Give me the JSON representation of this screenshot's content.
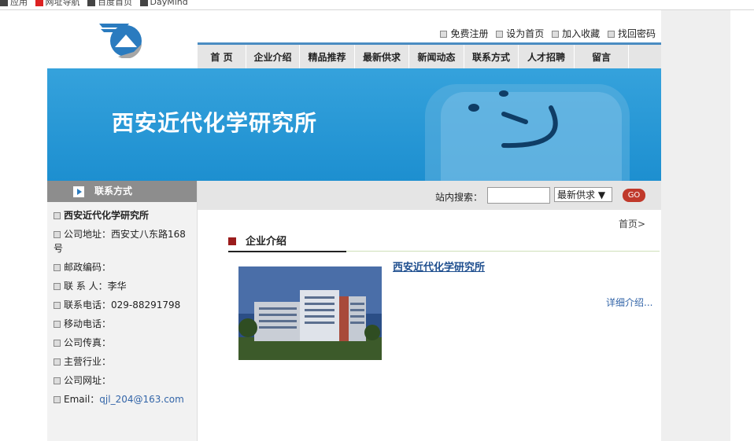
{
  "browser": {
    "bookmarks": [
      {
        "label": "应用",
        "icon": "apps-icon"
      },
      {
        "label": "网址导航",
        "icon": "hao123-icon"
      },
      {
        "label": "百度首页",
        "icon": "baidu-icon"
      },
      {
        "label": "DayMind",
        "icon": "daymind-icon"
      }
    ]
  },
  "header": {
    "links": [
      "免费注册",
      "设为首页",
      "加入收藏",
      "找回密码"
    ]
  },
  "nav": {
    "items": [
      "首 页",
      "企业介绍",
      "精品推荐",
      "最新供求",
      "新闻动态",
      "联系方式",
      "人才招聘",
      "留言"
    ]
  },
  "banner": {
    "title": "西安近代化学研究所"
  },
  "sidebar": {
    "title": "联系方式",
    "company": "西安近代化学研究所",
    "address": "公司地址：西安丈八东路168号",
    "postcode": "邮政编码：",
    "contact": "联 系 人：李华",
    "phone": "联系电话：029-88291798",
    "mobile": "移动电话：",
    "fax": "公司传真：",
    "industry": "主营行业：",
    "website": "公司网址：",
    "email_label": "Email：",
    "email": "qjl_204@163.com"
  },
  "search": {
    "label": "站内搜索：",
    "input_value": "",
    "select_value": "最新供求",
    "button": "GO"
  },
  "main": {
    "breadcrumb": "首页>",
    "section_title": "企业介绍",
    "company_link": "西安近代化学研究所",
    "more_link": "详细介绍..."
  },
  "colors": {
    "banner_blue": "#1d8fd0",
    "nav_accent": "#4a8cc2",
    "go_button": "#c0392b",
    "link_blue": "#3365a8"
  }
}
